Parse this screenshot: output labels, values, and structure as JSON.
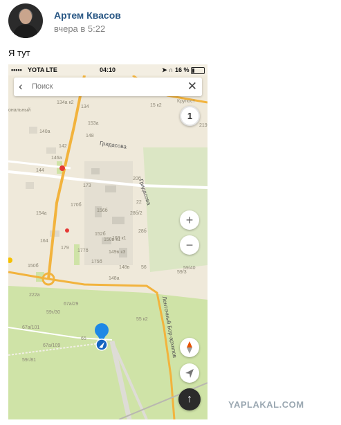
{
  "post": {
    "author": "Артем Квасов",
    "time": "вчера в 5:22",
    "text": "Я тут"
  },
  "phone": {
    "status": {
      "signal": "•••••",
      "carrier": "YOTA  LTE",
      "time": "04:10",
      "right": "➤ ∩ 16 %"
    },
    "search": {
      "placeholder": "Поиск"
    },
    "map": {
      "street_labels": [
        "Гридасова",
        "Гридасова",
        "Ленточный Бор-архипов"
      ],
      "labels": [
        "134а к2",
        "134",
        "140а",
        "142",
        "146а",
        "144",
        "153а",
        "148",
        "154а",
        "164",
        "150б",
        "152б",
        "156б",
        "170б",
        "173",
        "175б",
        "177б",
        "179",
        "148а",
        "148в",
        "149в к3",
        "150в к1",
        "169 к1",
        "20б",
        "22",
        "28б",
        "28б/2",
        "56",
        "55 к2",
        "59/3",
        "59/40",
        "59г/30",
        "67а/29",
        "67а/101",
        "67а/109",
        "59г/81",
        "65",
        "222а",
        "15 к2",
        "Крупост",
        "ональный",
        "219"
      ]
    },
    "buttons": {
      "traffic": "1",
      "zoom_in": "+",
      "zoom_out": "−",
      "route": "↑"
    }
  },
  "colors": {
    "link": "#2a5885",
    "pin": "#1e88e5",
    "road": "#f2b33d",
    "park": "#cfe3a7"
  },
  "watermark": "YAPLAKAL.COM"
}
